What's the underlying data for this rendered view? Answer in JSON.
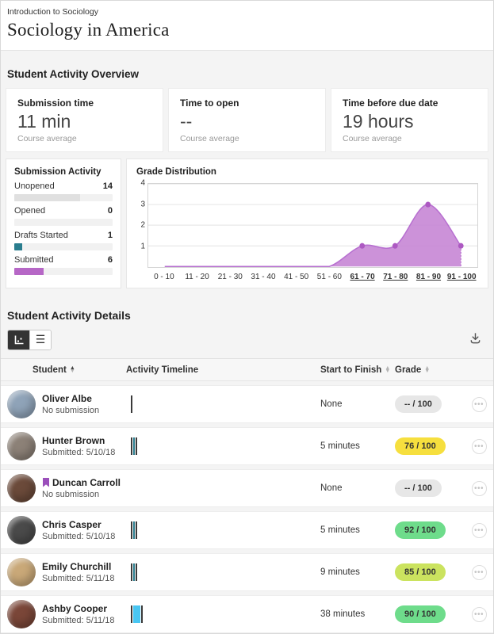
{
  "header": {
    "breadcrumb": "Introduction to Sociology",
    "title": "Sociology in America"
  },
  "overview": {
    "title": "Student Activity Overview",
    "cards": [
      {
        "label": "Submission time",
        "value": "11 min",
        "caption": "Course average"
      },
      {
        "label": "Time to open",
        "value": "--",
        "caption": "Course average"
      },
      {
        "label": "Time before due date",
        "value": "19 hours",
        "caption": "Course average"
      }
    ]
  },
  "submission_activity": {
    "title": "Submission Activity",
    "rows": [
      {
        "label": "Unopened",
        "value": "14",
        "pct": 67,
        "color": "#e0e0e0"
      },
      {
        "label": "Opened",
        "value": "0",
        "pct": 0,
        "color": "#e0e0e0"
      },
      {
        "label": "Drafts Started",
        "value": "1",
        "pct": 8,
        "color": "#2a7d8e"
      },
      {
        "label": "Submitted",
        "value": "6",
        "pct": 30,
        "color": "#b667c6"
      }
    ]
  },
  "chart_data": {
    "type": "area",
    "title": "Grade Distribution",
    "categories": [
      "0 - 10",
      "11 - 20",
      "21 - 30",
      "31 - 40",
      "41 - 50",
      "51 - 60",
      "61 - 70",
      "71 - 80",
      "81 - 90",
      "91 - 100"
    ],
    "values": [
      0,
      0,
      0,
      0,
      0,
      0,
      1,
      1,
      3,
      1
    ],
    "linked_categories": [
      "61 - 70",
      "71 - 80",
      "81 - 90",
      "91 - 100"
    ],
    "yticks": [
      4,
      3,
      2,
      1
    ],
    "ylim": [
      0,
      4
    ],
    "grid": true,
    "legend": "none",
    "fill_color": "#c583d4",
    "stroke_color": "#b76fd0",
    "dot_color": "#ad59c2"
  },
  "details": {
    "title": "Student Activity Details",
    "toolbar": {
      "chart_view": "chart-view",
      "list_view": "list-view",
      "download": "download"
    },
    "columns": {
      "student": "Student",
      "timeline": "Activity Timeline",
      "start_to_finish": "Start to Finish",
      "grade": "Grade"
    },
    "rows": [
      {
        "name": "Oliver Albe",
        "status": "No submission",
        "start_to_finish": "None",
        "grade": "-- / 100",
        "grade_color": "#e7e7e7",
        "flagged": false,
        "avatar_color": "#8fa3b8",
        "timeline": [
          {
            "type": "tick",
            "color": "#3a3a3a"
          }
        ]
      },
      {
        "name": "Hunter Brown",
        "status": "Submitted: 5/10/18",
        "start_to_finish": "5 minutes",
        "grade": "76 / 100",
        "grade_color": "#f6df3e",
        "flagged": false,
        "avatar_color": "#8c8177",
        "timeline": [
          {
            "type": "tick",
            "color": "#3a3a3a"
          },
          {
            "type": "tick",
            "color": "#2a7d8e"
          },
          {
            "type": "tick",
            "color": "#3a3a3a"
          }
        ]
      },
      {
        "name": "Duncan Carroll",
        "status": "No submission",
        "start_to_finish": "None",
        "grade": "-- / 100",
        "grade_color": "#e7e7e7",
        "flagged": true,
        "flag_color": "#9b4fbb",
        "avatar_color": "#6b4a3a",
        "timeline": []
      },
      {
        "name": "Chris Casper",
        "status": "Submitted: 5/10/18",
        "start_to_finish": "5 minutes",
        "grade": "92 / 100",
        "grade_color": "#6edc8b",
        "flagged": false,
        "avatar_color": "#4a4a4a",
        "timeline": [
          {
            "type": "tick",
            "color": "#3a3a3a"
          },
          {
            "type": "tick",
            "color": "#2a7d8e"
          },
          {
            "type": "tick",
            "color": "#3a3a3a"
          }
        ]
      },
      {
        "name": "Emily Churchill",
        "status": "Submitted: 5/11/18",
        "start_to_finish": "9 minutes",
        "grade": "85 / 100",
        "grade_color": "#cbe35f",
        "flagged": false,
        "avatar_color": "#c9a878",
        "timeline": [
          {
            "type": "tick",
            "color": "#3a3a3a"
          },
          {
            "type": "tick",
            "color": "#2a7d8e"
          },
          {
            "type": "tick",
            "color": "#3a3a3a"
          }
        ]
      },
      {
        "name": "Ashby Cooper",
        "status": "Submitted: 5/11/18",
        "start_to_finish": "38 minutes",
        "grade": "90 / 100",
        "grade_color": "#6edc8b",
        "flagged": false,
        "avatar_color": "#7a4638",
        "timeline": [
          {
            "type": "tick",
            "color": "#3a3a3a"
          },
          {
            "type": "bar",
            "color": "#49c6f2"
          },
          {
            "type": "tick",
            "color": "#3a3a3a"
          }
        ]
      }
    ]
  }
}
